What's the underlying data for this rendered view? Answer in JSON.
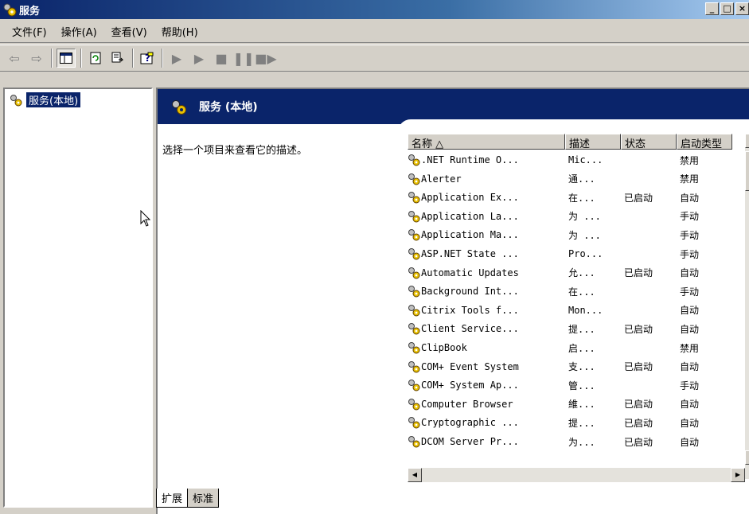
{
  "window": {
    "title": "服务",
    "buttons": [
      "_",
      "□",
      "×"
    ]
  },
  "menu": [
    "文件(F)",
    "操作(A)",
    "查看(V)",
    "帮助(H)"
  ],
  "toolbar_icons": [
    "back-icon",
    "forward-icon",
    "show-tree-icon",
    "refresh-icon",
    "export-list-icon",
    "help-icon",
    "start-icon",
    "start-alt-icon",
    "stop-icon",
    "pause-icon",
    "restart-icon"
  ],
  "tree": {
    "item": "服务(本地)"
  },
  "banner": {
    "title": "服务 (本地)"
  },
  "description": "选择一个项目来查看它的描述。",
  "columns": [
    "名称 △",
    "描述",
    "状态",
    "启动类型"
  ],
  "rows": [
    [
      ".NET Runtime O...",
      "Mic...",
      "",
      "禁用"
    ],
    [
      "Alerter",
      "通...",
      "",
      "禁用"
    ],
    [
      "Application Ex...",
      "在...",
      "已启动",
      "自动"
    ],
    [
      "Application La...",
      "为 ...",
      "",
      "手动"
    ],
    [
      "Application Ma...",
      "为 ...",
      "",
      "手动"
    ],
    [
      "ASP.NET State ...",
      "Pro...",
      "",
      "手动"
    ],
    [
      "Automatic Updates",
      "允...",
      "已启动",
      "自动"
    ],
    [
      "Background Int...",
      "在...",
      "",
      "手动"
    ],
    [
      "Citrix Tools f...",
      "Mon...",
      "",
      "自动"
    ],
    [
      "Client Service...",
      "提...",
      "已启动",
      "自动"
    ],
    [
      "ClipBook",
      "启...",
      "",
      "禁用"
    ],
    [
      "COM+ Event System",
      "支...",
      "已启动",
      "自动"
    ],
    [
      "COM+ System Ap...",
      "管...",
      "",
      "手动"
    ],
    [
      "Computer Browser",
      "維...",
      "已启动",
      "自动"
    ],
    [
      "Cryptographic ...",
      "提...",
      "已启动",
      "自动"
    ],
    [
      "DCOM Server Pr...",
      "为...",
      "已启动",
      "自动"
    ]
  ],
  "tabs": [
    "扩展",
    "标准"
  ]
}
